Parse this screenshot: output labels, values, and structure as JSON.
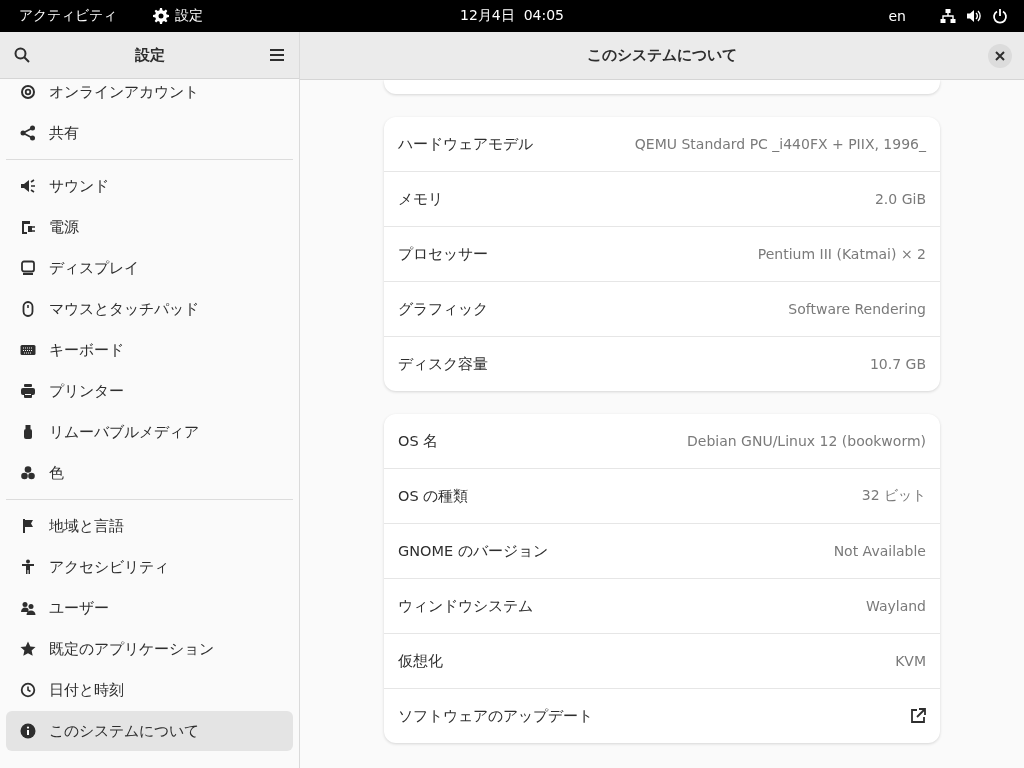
{
  "top_bar": {
    "activities": "アクティビティ",
    "app_name": "設定",
    "clock": "12月4日  04:05",
    "keyboard_layout": "en"
  },
  "sidebar": {
    "title": "設定",
    "groups": [
      [
        {
          "label": "オンラインアカウント",
          "selected": false
        },
        {
          "label": "共有",
          "selected": false
        }
      ],
      [
        {
          "label": "サウンド",
          "selected": false
        },
        {
          "label": "電源",
          "selected": false
        },
        {
          "label": "ディスプレイ",
          "selected": false
        },
        {
          "label": "マウスとタッチパッド",
          "selected": false
        },
        {
          "label": "キーボード",
          "selected": false
        },
        {
          "label": "プリンター",
          "selected": false
        },
        {
          "label": "リムーバブルメディア",
          "selected": false
        },
        {
          "label": "色",
          "selected": false
        }
      ],
      [
        {
          "label": "地域と言語",
          "selected": false
        },
        {
          "label": "アクセシビリティ",
          "selected": false
        },
        {
          "label": "ユーザー",
          "selected": false
        },
        {
          "label": "既定のアプリケーション",
          "selected": false
        },
        {
          "label": "日付と時刻",
          "selected": false
        },
        {
          "label": "このシステムについて",
          "selected": true
        }
      ]
    ]
  },
  "main": {
    "title": "このシステムについて",
    "cards": [
      [
        {
          "kind": "text",
          "label": "ハードウェアモデル",
          "value": "QEMU Standard PC _i440FX + PIIX, 1996_"
        },
        {
          "kind": "text",
          "label": "メモリ",
          "value": "2.0 GiB"
        },
        {
          "kind": "text",
          "label": "プロセッサー",
          "value": "Pentium III (Katmai) × 2"
        },
        {
          "kind": "text",
          "label": "グラフィック",
          "value": "Software Rendering"
        },
        {
          "kind": "text",
          "label": "ディスク容量",
          "value": "10.7 GB"
        }
      ],
      [
        {
          "kind": "text",
          "label": "OS 名",
          "value": "Debian GNU/Linux 12 (bookworm)"
        },
        {
          "kind": "text",
          "label": "OS の種類",
          "value": "32 ビット"
        },
        {
          "kind": "text",
          "label": "GNOME のバージョン",
          "value": "Not Available"
        },
        {
          "kind": "text",
          "label": "ウィンドウシステム",
          "value": "Wayland"
        },
        {
          "kind": "text",
          "label": "仮想化",
          "value": "KVM"
        },
        {
          "kind": "link",
          "label": "ソフトウェアのアップデート"
        }
      ]
    ]
  }
}
